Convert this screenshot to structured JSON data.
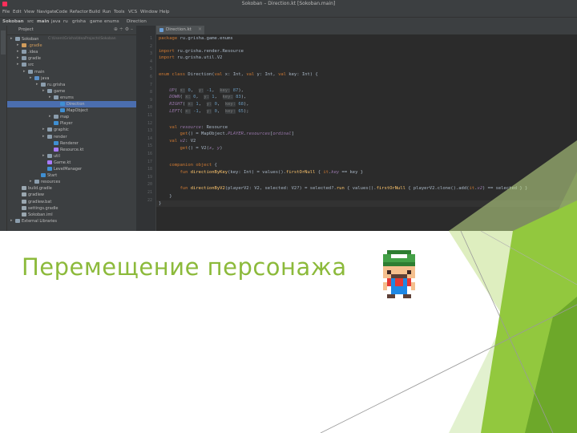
{
  "window": {
    "title": "Sokoban – Direction.kt [Sokoban.main]"
  },
  "menu": [
    "File",
    "Edit",
    "View",
    "Navigate",
    "Code",
    "Refactor",
    "Build",
    "Run",
    "Tools",
    "VCS",
    "Window",
    "Help"
  ],
  "breadcrumbs": [
    "Sokoban",
    "src",
    "main",
    "java",
    "ru",
    "grisha",
    "game",
    "enums",
    "Direction"
  ],
  "project_panel": {
    "title": "Project",
    "side_tab": "1: Project",
    "tree": [
      {
        "label": "Sokoban",
        "path": "C:\\Users\\Grisha\\IdeaProjects\\Sokoban",
        "depth": 0,
        "type": "folder"
      },
      {
        "label": ".gradle",
        "depth": 1,
        "type": "folder-orange"
      },
      {
        "label": ".idea",
        "depth": 1,
        "type": "folder"
      },
      {
        "label": "gradle",
        "depth": 1,
        "type": "folder"
      },
      {
        "label": "src",
        "depth": 1,
        "type": "folder"
      },
      {
        "label": "main",
        "depth": 2,
        "type": "folder"
      },
      {
        "label": "java",
        "depth": 3,
        "type": "folder-blue"
      },
      {
        "label": "ru.grisha",
        "depth": 4,
        "type": "package"
      },
      {
        "label": "game",
        "depth": 5,
        "type": "package"
      },
      {
        "label": "enums",
        "depth": 6,
        "type": "package"
      },
      {
        "label": "Direction",
        "depth": 7,
        "type": "class",
        "selected": true
      },
      {
        "label": "MapObject",
        "depth": 7,
        "type": "class"
      },
      {
        "label": "map",
        "depth": 6,
        "type": "package"
      },
      {
        "label": "Player",
        "depth": 6,
        "type": "class"
      },
      {
        "label": "graphic",
        "depth": 5,
        "type": "package"
      },
      {
        "label": "render",
        "depth": 5,
        "type": "package"
      },
      {
        "label": "Renderer",
        "depth": 6,
        "type": "class"
      },
      {
        "label": "Resource.kt",
        "depth": 6,
        "type": "kt"
      },
      {
        "label": "util",
        "depth": 5,
        "type": "package"
      },
      {
        "label": "Game.kt",
        "depth": 5,
        "type": "kt"
      },
      {
        "label": "LevelManager",
        "depth": 5,
        "type": "class"
      },
      {
        "label": "Start",
        "depth": 4,
        "type": "class"
      },
      {
        "label": "resources",
        "depth": 3,
        "type": "folder"
      },
      {
        "label": "build.gradle",
        "depth": 1,
        "type": "file"
      },
      {
        "label": "gradlew",
        "depth": 1,
        "type": "file"
      },
      {
        "label": "gradlew.bat",
        "depth": 1,
        "type": "file"
      },
      {
        "label": "settings.gradle",
        "depth": 1,
        "type": "file"
      },
      {
        "label": "Sokoban.iml",
        "depth": 1,
        "type": "file"
      },
      {
        "label": "External Libraries",
        "depth": 0,
        "type": "lib"
      }
    ]
  },
  "editor": {
    "tab": "Direction.kt",
    "lines": [
      "1",
      "2",
      "3",
      "4",
      "5",
      "6",
      "7",
      "8",
      "9",
      "10",
      "11",
      "12",
      "13",
      "14",
      "15",
      "16",
      "17",
      "18",
      "19",
      "20",
      "21",
      "22"
    ]
  },
  "slide": {
    "title": "Перемещение персонажа"
  },
  "colors": {
    "accent_green": "#8cba3b",
    "ide_bg": "#2b2b2b",
    "keyword": "#cc7832"
  }
}
